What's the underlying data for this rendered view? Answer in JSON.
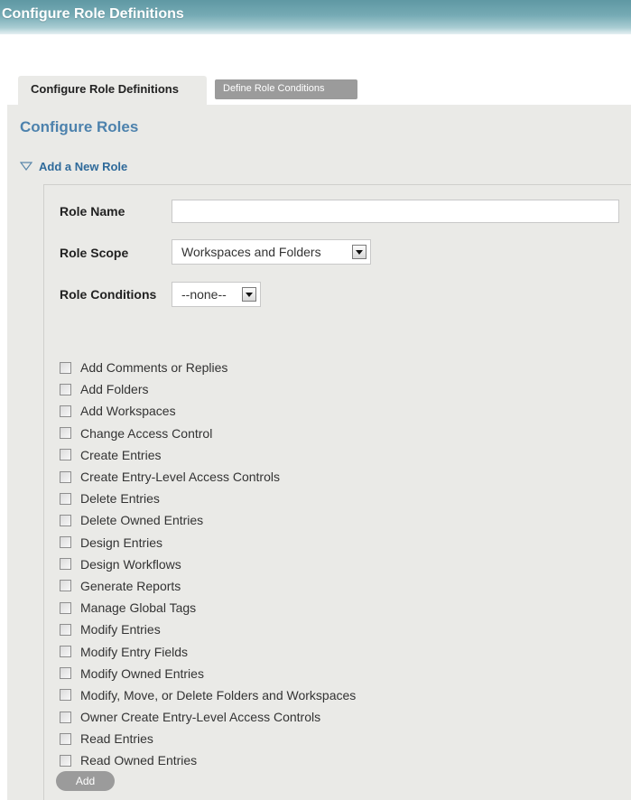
{
  "window": {
    "title": "Configure Role Definitions"
  },
  "tabs": [
    {
      "label": "Configure Role Definitions",
      "active": true
    },
    {
      "label": "Define Role Conditions",
      "active": false
    }
  ],
  "panel": {
    "title": "Configure Roles",
    "section_toggle": "Add a New Role",
    "section_icon": "triangle-down-icon"
  },
  "form": {
    "role_name": {
      "label": "Role Name",
      "value": ""
    },
    "role_scope": {
      "label": "Role Scope",
      "selected": "Workspaces and Folders"
    },
    "role_conditions": {
      "label": "Role Conditions",
      "selected": "--none--"
    }
  },
  "permissions": [
    {
      "label": "Add Comments or Replies",
      "checked": false
    },
    {
      "label": "Add Folders",
      "checked": false
    },
    {
      "label": "Add Workspaces",
      "checked": false
    },
    {
      "label": "Change Access Control",
      "checked": false
    },
    {
      "label": "Create Entries",
      "checked": false
    },
    {
      "label": "Create Entry-Level Access Controls",
      "checked": false
    },
    {
      "label": "Delete Entries",
      "checked": false
    },
    {
      "label": "Delete Owned Entries",
      "checked": false
    },
    {
      "label": "Design Entries",
      "checked": false
    },
    {
      "label": "Design Workflows",
      "checked": false
    },
    {
      "label": "Generate Reports",
      "checked": false
    },
    {
      "label": "Manage Global Tags",
      "checked": false
    },
    {
      "label": "Modify Entries",
      "checked": false
    },
    {
      "label": "Modify Entry Fields",
      "checked": false
    },
    {
      "label": "Modify Owned Entries",
      "checked": false
    },
    {
      "label": "Modify, Move, or Delete Folders and Workspaces",
      "checked": false
    },
    {
      "label": "Owner Create Entry-Level Access Controls",
      "checked": false
    },
    {
      "label": "Read Entries",
      "checked": false
    },
    {
      "label": "Read Owned Entries",
      "checked": false
    }
  ],
  "actions": {
    "add_label": "Add"
  },
  "colors": {
    "title_bar": "#6fa5b0",
    "panel_bg": "#eaeae7",
    "heading_blue": "#4d82ad",
    "link_blue": "#2f6a9a",
    "button_gray": "#9b9b9b"
  }
}
